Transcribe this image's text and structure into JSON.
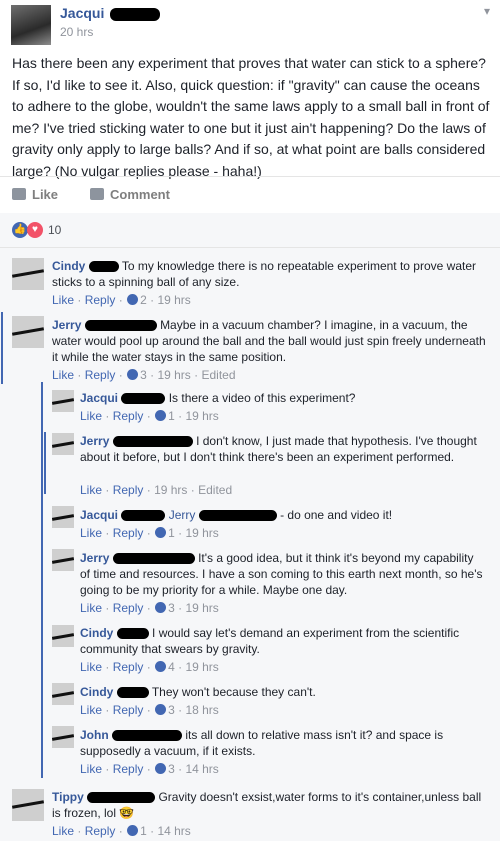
{
  "post": {
    "author": "Jacqui",
    "time": "20 hrs",
    "text": "Has there been any experiment that proves that water can stick to a sphere? If so, I'd like to see it. Also, quick question: if \"gravity\" can cause the oceans to adhere to the globe, wouldn't the same laws apply to a small ball in front of me? I've tried sticking water to one but it just ain't happening? Do the laws of gravity only apply to large balls? And if so, at what point are balls considered large? (No vulgar replies please - haha!)",
    "actions": {
      "like": "Like",
      "comment": "Comment"
    },
    "reaction_count": "10",
    "colors": {
      "like_blue": "#4267b2",
      "love_red": "#f25268"
    }
  },
  "ui": {
    "like": "Like",
    "reply": "Reply",
    "dot": "·",
    "edited": "Edited"
  },
  "comments": [
    {
      "name": "Cindy",
      "text": "To my knowledge there is no repeatable experiment to prove water sticks to a spinning ball of any size.",
      "likes": "2",
      "time": "19 hrs"
    },
    {
      "name": "Jerry",
      "text": "Maybe in a vacuum chamber? I imagine, in a vacuum, the water would pool up around the ball and the ball would just spin freely underneath it while the water stays in the same position.",
      "likes": "3",
      "time": "19 hrs",
      "edited": true
    },
    {
      "name": "Jacqui",
      "text": "Is there a video of this experiment?",
      "likes": "1",
      "time": "19 hrs"
    },
    {
      "name": "Jerry",
      "text": "I don't know, I just made that hypothesis. I've thought about it before, but I don't think there's been an experiment performed.",
      "likes": "",
      "time": "19 hrs",
      "edited": true
    },
    {
      "name": "Jacqui",
      "mention": "Jerry",
      "text": "- do one and video it!",
      "likes": "1",
      "time": "19 hrs"
    },
    {
      "name": "Jerry",
      "text": "It's a good idea, but it think it's beyond my capability of time and resources. I have a son coming to this earth next month, so he's going to be my priority for a while. Maybe one day.",
      "likes": "3",
      "time": "19 hrs"
    },
    {
      "name": "Cindy",
      "text": "I would say let's demand an experiment from the scientific community that swears by gravity.",
      "likes": "4",
      "time": "19 hrs"
    },
    {
      "name": "Cindy",
      "text": "They won't because they can't.",
      "likes": "3",
      "time": "18 hrs"
    },
    {
      "name": "John",
      "text": "its all down to relative mass isn't it? and space is supposedly a vacuum, if it exists.",
      "likes": "3",
      "time": "14 hrs"
    },
    {
      "name": "Tippy",
      "text": "Gravity doesn't exsist,water forms to it's container,unless ball is frozen, lol",
      "emoji": "🤓",
      "likes": "1",
      "time": "14 hrs"
    }
  ]
}
